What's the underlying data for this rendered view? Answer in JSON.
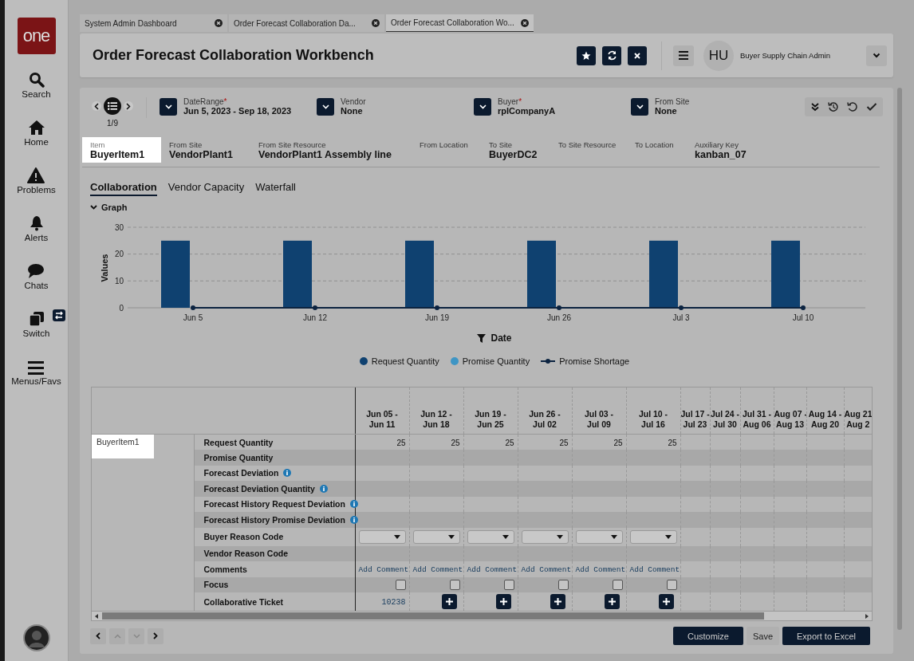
{
  "sidebar": {
    "logo": "one",
    "items": [
      {
        "label": "Search"
      },
      {
        "label": "Home"
      },
      {
        "label": "Problems"
      },
      {
        "label": "Alerts"
      },
      {
        "label": "Chats"
      },
      {
        "label": "Switch"
      },
      {
        "label": "Menus/Favs"
      }
    ]
  },
  "tabs": [
    {
      "label": "System Admin Dashboard",
      "selected": false
    },
    {
      "label": "Order Forecast Collaboration Da...",
      "selected": false
    },
    {
      "label": "Order Forecast Collaboration Wo...",
      "selected": true
    }
  ],
  "header": {
    "title": "Order Forecast Collaboration Workbench",
    "avatar": "HU",
    "role": "Buyer Supply Chain Admin"
  },
  "pager": "1/9",
  "filters": [
    {
      "label": "DateRange",
      "required_mark": "*",
      "value": "Jun 5, 2023 - Sep 18, 2023"
    },
    {
      "label": "Vendor",
      "value": "None"
    },
    {
      "label": "Buyer",
      "required_mark": "*",
      "value": "rplCompanyA"
    },
    {
      "label": "From Site",
      "value": "None"
    }
  ],
  "info": [
    {
      "label": "Item",
      "value": "BuyerItem1",
      "highlighted": true
    },
    {
      "label": "From Site",
      "value": "VendorPlant1",
      "highlighted": false
    },
    {
      "label": "From Site Resource",
      "value": "VendorPlant1 Assembly line",
      "highlighted": false
    },
    {
      "label": "From Location",
      "highlighted": false
    },
    {
      "label": "To Site",
      "value": "BuyerDC2",
      "highlighted": false
    },
    {
      "label": "To Site Resource",
      "highlighted": false
    },
    {
      "label": "To Location",
      "highlighted": false
    },
    {
      "label": "Auxiliary Key",
      "value": "kanban_07",
      "highlighted": false
    }
  ],
  "subtabs": [
    {
      "label": "Collaboration",
      "selected": true
    },
    {
      "label": "Vendor Capacity",
      "selected": false
    },
    {
      "label": "Waterfall",
      "selected": false
    }
  ],
  "graph": {
    "label": "Graph",
    "expanded": true,
    "chart_data": {
      "type": "bar",
      "xlabel": "Date",
      "ylabel": "Values",
      "categories": [
        "Jun 5",
        "Jun 12",
        "Jun 19",
        "Jun 26",
        "Jul 3",
        "Jul 10"
      ],
      "ylim": [
        0,
        30
      ],
      "yticks": [
        0,
        10,
        20,
        30
      ],
      "series": [
        {
          "name": "Request Quantity",
          "color": "#0f4170",
          "values": [
            25,
            25,
            25,
            25,
            25,
            25
          ]
        },
        {
          "name": "Promise Quantity",
          "color": "#3e95c4",
          "values": [
            null,
            null,
            null,
            null,
            null,
            null
          ]
        },
        {
          "name": "Promise Shortage",
          "color": "#0b2340",
          "values": [
            0,
            0,
            0,
            0,
            0,
            0
          ]
        }
      ]
    }
  },
  "table": {
    "item": {
      "value": "BuyerItem1",
      "highlighted": true
    },
    "columns": [
      {
        "line1": "Jun 05 -",
        "line2": "Jun 11"
      },
      {
        "line1": "Jun 12 -",
        "line2": "Jun 18"
      },
      {
        "line1": "Jun 19 -",
        "line2": "Jun 25"
      },
      {
        "line1": "Jun 26 -",
        "line2": "Jul 02"
      },
      {
        "line1": "Jul 03 -",
        "line2": "Jul 09"
      },
      {
        "line1": "Jul 10 -",
        "line2": "Jul 16"
      },
      {
        "line1": "Jul 17 -",
        "line2": "Jul 23"
      },
      {
        "line1": "Jul 24 -",
        "line2": "Jul 30"
      },
      {
        "line1": "Jul 31 -",
        "line2": "Aug 06"
      },
      {
        "line1": "Aug 07 -",
        "line2": "Aug 13"
      },
      {
        "line1": "Aug 14 -",
        "line2": "Aug 20"
      },
      {
        "line1": "Aug 21",
        "line2": "Aug 2"
      }
    ],
    "rows": [
      {
        "label": "Request Quantity",
        "info": false,
        "cells": [
          {
            "kind": "number",
            "text": "25"
          },
          {
            "kind": "number",
            "text": "25"
          },
          {
            "kind": "number",
            "text": "25"
          },
          {
            "kind": "number",
            "text": "25"
          },
          {
            "kind": "number",
            "text": "25"
          },
          {
            "kind": "number",
            "text": "25"
          }
        ]
      },
      {
        "label": "Promise Quantity",
        "info": false,
        "cells": []
      },
      {
        "label": "Forecast Deviation",
        "info": true,
        "cells": []
      },
      {
        "label": "Forecast Deviation Quantity",
        "info": true,
        "cells": []
      },
      {
        "label": "Forecast History Request Deviation",
        "info": true,
        "cells": []
      },
      {
        "label": "Forecast History Promise Deviation",
        "info": true,
        "cells": []
      },
      {
        "label": "Buyer Reason Code",
        "info": false,
        "cells": [
          {
            "kind": "dropdown"
          },
          {
            "kind": "dropdown"
          },
          {
            "kind": "dropdown"
          },
          {
            "kind": "dropdown"
          },
          {
            "kind": "dropdown"
          },
          {
            "kind": "dropdown"
          }
        ]
      },
      {
        "label": "Vendor Reason Code",
        "info": false,
        "cells": []
      },
      {
        "label": "Comments",
        "info": false,
        "cells": [
          {
            "kind": "link",
            "text": "Add Comment"
          },
          {
            "kind": "link",
            "text": "Add Comment"
          },
          {
            "kind": "link",
            "text": "Add Comment"
          },
          {
            "kind": "link",
            "text": "Add Comment"
          },
          {
            "kind": "link",
            "text": "Add Comment"
          },
          {
            "kind": "link",
            "text": "Add Comment"
          }
        ]
      },
      {
        "label": "Focus",
        "info": false,
        "cells": [
          {
            "kind": "checkbox",
            "checked": false
          },
          {
            "kind": "checkbox",
            "checked": false
          },
          {
            "kind": "checkbox",
            "checked": false
          },
          {
            "kind": "checkbox",
            "checked": false
          },
          {
            "kind": "checkbox",
            "checked": false
          },
          {
            "kind": "checkbox",
            "checked": false
          }
        ]
      },
      {
        "label": "Collaborative Ticket",
        "info": false,
        "cells": [
          {
            "kind": "ticket",
            "text": "10238"
          },
          {
            "kind": "add"
          },
          {
            "kind": "add"
          },
          {
            "kind": "add"
          },
          {
            "kind": "add"
          },
          {
            "kind": "add"
          }
        ]
      }
    ]
  },
  "footer": {
    "buttons": [
      "Customize",
      "Save",
      "Export to Excel"
    ]
  }
}
